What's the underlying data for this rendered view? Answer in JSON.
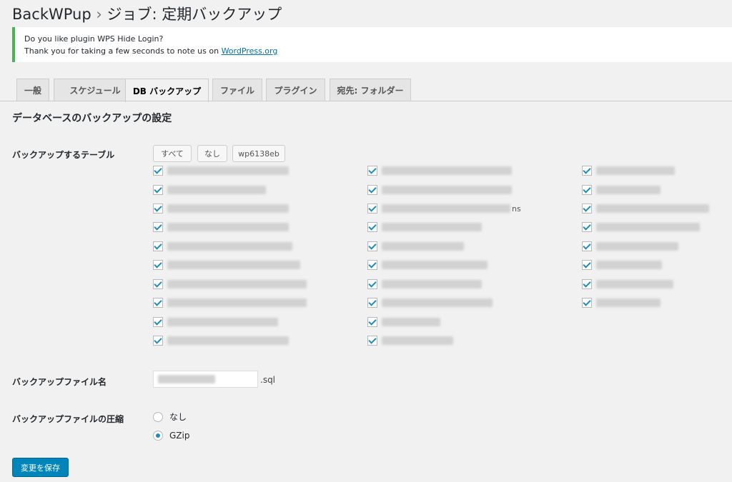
{
  "header": {
    "plugin": "BackWPup",
    "separator": "›",
    "job_title": "ジョブ: 定期バックアップ"
  },
  "notice": {
    "line1": "Do you like plugin WPS Hide Login?",
    "line2_prefix": "Thank you for taking a few seconds to note us on ",
    "link_text": "WordPress.org",
    "accent_color": "#46b450"
  },
  "tabs": [
    {
      "label": "一般"
    },
    {
      "label": "スケジュール"
    },
    {
      "label": "DB バックアップ",
      "active": true
    },
    {
      "label": "ファイル"
    },
    {
      "label": "プラグイン"
    },
    {
      "label": "宛先: フォルダー"
    }
  ],
  "section_title": "データベースのバックアップの設定",
  "tables_setting": {
    "label": "バックアップするテーブル",
    "buttons": {
      "all": "すべて",
      "none": "なし",
      "prefix": "wp6138eb"
    },
    "checked": true,
    "visible_suffix": "ns"
  },
  "filename_setting": {
    "label": "バックアップファイル名",
    "extension": ".sql"
  },
  "compression_setting": {
    "label": "バックアップファイルの圧縮",
    "options": [
      {
        "label": "なし",
        "selected": false
      },
      {
        "label": "GZip",
        "selected": true
      }
    ]
  },
  "save_button": {
    "label": "変更を保存",
    "color": "#0085ba"
  }
}
